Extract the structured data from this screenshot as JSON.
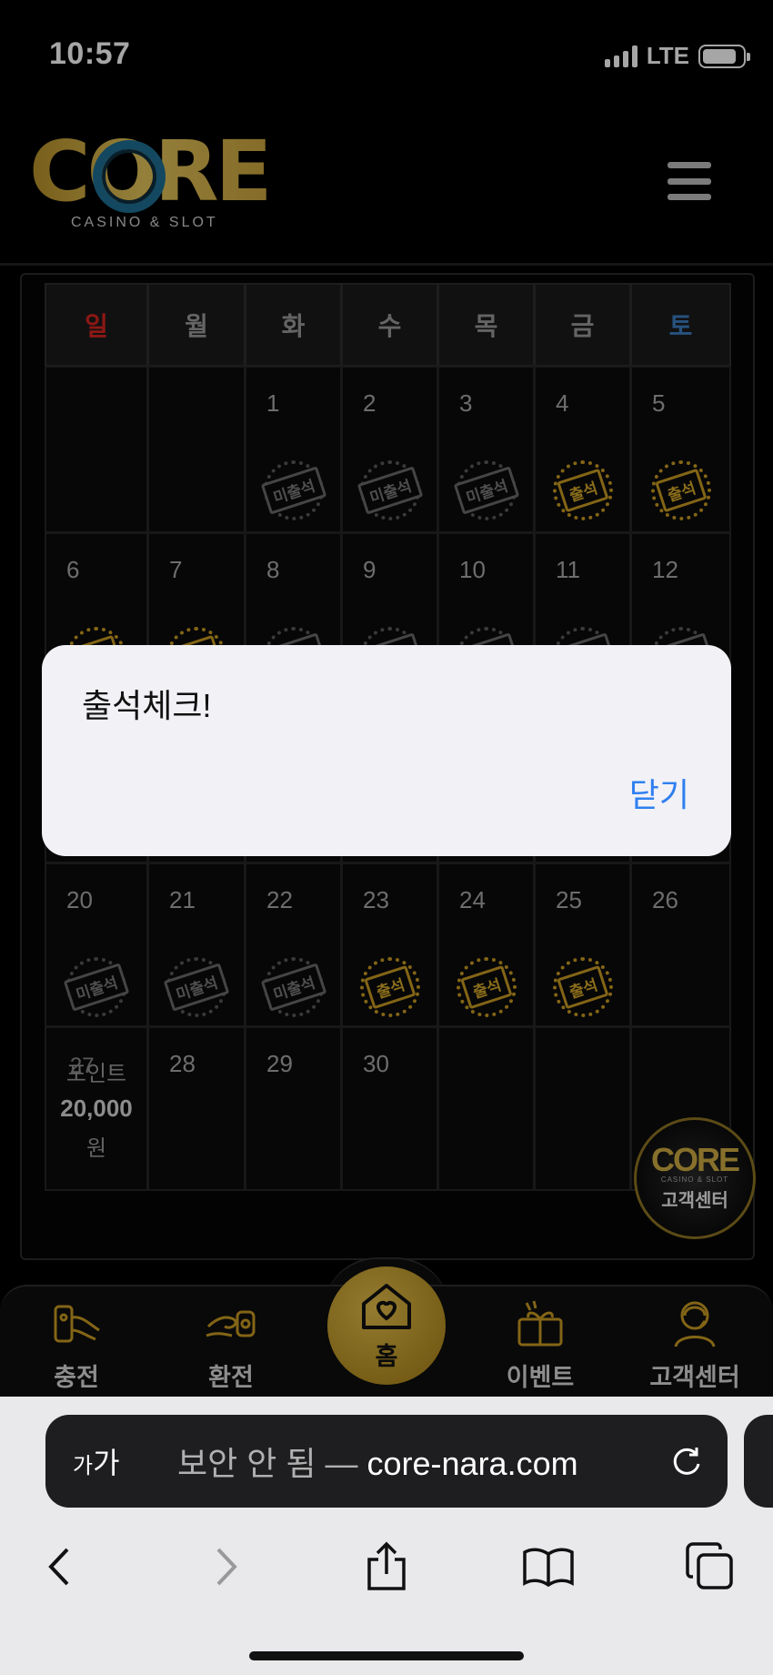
{
  "status": {
    "time": "10:57",
    "network": "LTE",
    "battery_level": 0.85
  },
  "header": {
    "logo_text": "CORE",
    "logo_subtitle": "CASINO & SLOT",
    "menu_icon": "hamburger-icon"
  },
  "calendar": {
    "weekdays": [
      "일",
      "월",
      "화",
      "수",
      "목",
      "금",
      "토"
    ],
    "stamp_absent": "미출석",
    "stamp_present": "출석",
    "weeks": [
      [
        {
          "d": ""
        },
        {
          "d": ""
        },
        {
          "d": "1",
          "s": "absent"
        },
        {
          "d": "2",
          "s": "absent"
        },
        {
          "d": "3",
          "s": "absent"
        },
        {
          "d": "4",
          "s": "present"
        },
        {
          "d": "5",
          "s": "present"
        }
      ],
      [
        {
          "d": "6",
          "s": "present"
        },
        {
          "d": "7",
          "s": "present"
        },
        {
          "d": "8",
          "s": "absent"
        },
        {
          "d": "9",
          "s": "absent"
        },
        {
          "d": "10",
          "s": "absent"
        },
        {
          "d": "11",
          "s": "absent"
        },
        {
          "d": "12",
          "s": "absent"
        }
      ],
      [
        {
          "d": ""
        },
        {
          "d": ""
        },
        {
          "d": ""
        },
        {
          "d": ""
        },
        {
          "d": ""
        },
        {
          "d": ""
        },
        {
          "d": ""
        }
      ],
      [
        {
          "d": "20",
          "s": "absent"
        },
        {
          "d": "21",
          "s": "absent"
        },
        {
          "d": "22",
          "s": "absent"
        },
        {
          "d": "23",
          "s": "present"
        },
        {
          "d": "24",
          "s": "present"
        },
        {
          "d": "25",
          "s": "present"
        },
        {
          "d": "26"
        }
      ],
      [
        {
          "d": "27"
        },
        {
          "d": "28"
        },
        {
          "d": "29"
        },
        {
          "d": "30"
        },
        {
          "d": ""
        },
        {
          "d": ""
        },
        {
          "d": ""
        }
      ]
    ],
    "point": {
      "label": "포인트",
      "amount": "20,000",
      "unit": "원"
    }
  },
  "cs_float": {
    "logo": "CORE",
    "sub": "CASINO & SLOT",
    "label": "고객센터"
  },
  "bottom_nav": {
    "items": [
      {
        "label": "충전",
        "icon": "deposit-icon"
      },
      {
        "label": "환전",
        "icon": "withdraw-icon"
      },
      {
        "label": "홈",
        "icon": "home-heart-icon"
      },
      {
        "label": "이벤트",
        "icon": "gift-icon"
      },
      {
        "label": "고객센터",
        "icon": "support-icon"
      }
    ]
  },
  "browser": {
    "aa_small": "가",
    "aa_large": "가",
    "insecure": "보안 안 됨",
    "separator": " — ",
    "domain": "core-nara.com"
  },
  "alert": {
    "title": "출석체크!",
    "close_label": "닫기"
  },
  "colors": {
    "accent_gold": "#c99b22",
    "sunday": "#d8261f",
    "saturday": "#3d7fc4",
    "link_blue": "#2f7ff0"
  }
}
